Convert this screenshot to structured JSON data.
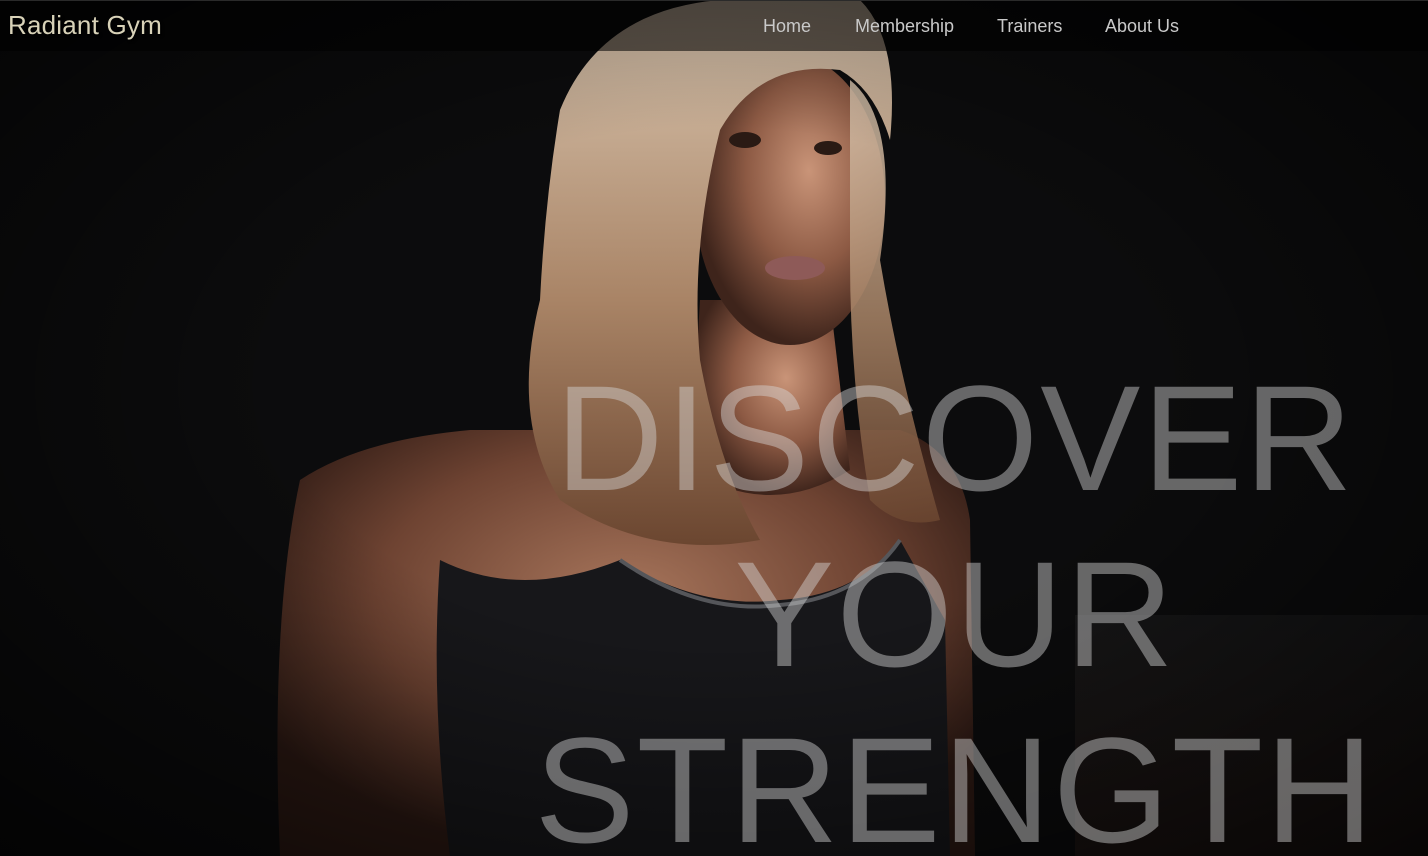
{
  "brand": {
    "name": "Radiant Gym"
  },
  "nav": {
    "items": [
      {
        "label": "Home"
      },
      {
        "label": "Membership"
      },
      {
        "label": "Trainers"
      },
      {
        "label": "About Us"
      }
    ]
  },
  "hero": {
    "headline_lines": [
      "DISCOVER",
      "YOUR",
      "STRENGTH"
    ],
    "image": "woman-athlete-portrait"
  },
  "colors": {
    "background": "#0b0b0c",
    "brand_text": "#d8d2b8",
    "nav_text": "#c9c9c9",
    "headline_text": "#d7d7d7"
  }
}
